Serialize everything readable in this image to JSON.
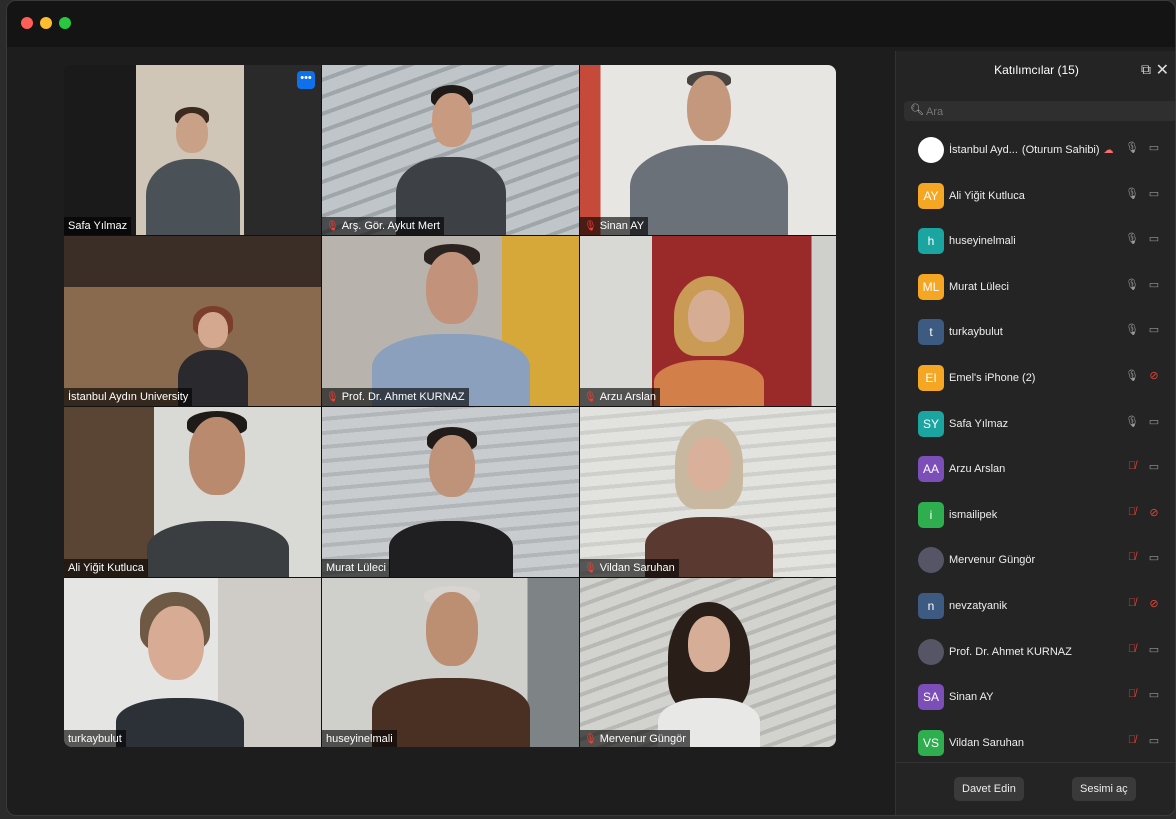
{
  "app": {
    "window_title": ""
  },
  "gallery": {
    "more_button": "•••",
    "tiles": [
      {
        "name": "Safa Yılmaz",
        "muted": false
      },
      {
        "name": "Arş. Gör. Aykut Mert",
        "muted": true
      },
      {
        "name": "Sinan AY",
        "muted": true
      },
      {
        "name": "İstanbul Aydın University",
        "muted": false
      },
      {
        "name": "Prof. Dr. Ahmet KURNAZ",
        "muted": true
      },
      {
        "name": "Arzu Arslan",
        "muted": true
      },
      {
        "name": "Ali Yiğit Kutluca",
        "muted": false
      },
      {
        "name": "Murat Lüleci",
        "muted": false
      },
      {
        "name": "Vildan Saruhan",
        "muted": true
      },
      {
        "name": "turkaybulut",
        "muted": false
      },
      {
        "name": "huseyinelmali",
        "muted": false
      },
      {
        "name": "Mervenur Güngör",
        "muted": true
      }
    ]
  },
  "participants_panel": {
    "title": "Katılımcılar (15)",
    "search_placeholder": "Ara",
    "participants": [
      {
        "name": "İstanbul Ayd...",
        "host_label": "(Oturum Sahibi)",
        "initials": "",
        "avatar_color": "#ffffff",
        "photo": true,
        "mic": "on",
        "cam": "on"
      },
      {
        "name": "Ali Yiğit Kutluca",
        "initials": "AY",
        "avatar_color": "#f5a623",
        "mic": "on",
        "cam": "on"
      },
      {
        "name": "huseyinelmali",
        "initials": "h",
        "avatar_color": "#1aa5a0",
        "mic": "on",
        "cam": "on"
      },
      {
        "name": "Murat Lüleci",
        "initials": "ML",
        "avatar_color": "#f5a623",
        "mic": "speaking",
        "cam": "on"
      },
      {
        "name": "turkaybulut",
        "initials": "t",
        "avatar_color": "#3d5a80",
        "mic": "on",
        "cam": "on"
      },
      {
        "name": "Emel's iPhone (2)",
        "initials": "EI",
        "avatar_color": "#f5a623",
        "mic": "on",
        "cam": "off"
      },
      {
        "name": "Safa Yılmaz",
        "initials": "SY",
        "avatar_color": "#1aa5a0",
        "mic": "on",
        "cam": "on"
      },
      {
        "name": "Arzu Arslan",
        "initials": "AA",
        "avatar_color": "#7b4fb7",
        "mic": "off",
        "cam": "on"
      },
      {
        "name": "ismailipek",
        "initials": "i",
        "avatar_color": "#2eae4f",
        "mic": "off",
        "cam": "off"
      },
      {
        "name": "Mervenur Güngör",
        "initials": "",
        "avatar_color": "#555566",
        "photo": true,
        "mic": "off",
        "cam": "on"
      },
      {
        "name": "nevzatyanik",
        "initials": "n",
        "avatar_color": "#3d5a80",
        "mic": "off",
        "cam": "off"
      },
      {
        "name": "Prof. Dr. Ahmet KURNAZ",
        "initials": "",
        "avatar_color": "#555566",
        "photo": true,
        "mic": "off",
        "cam": "on"
      },
      {
        "name": "Sinan AY",
        "initials": "SA",
        "avatar_color": "#7b4fb7",
        "mic": "off",
        "cam": "on"
      },
      {
        "name": "Vildan Saruhan",
        "initials": "VS",
        "avatar_color": "#2eae4f",
        "mic": "off",
        "cam": "on"
      }
    ],
    "invite_label": "Davet Edin",
    "unmute_label": "Sesimi aç"
  }
}
